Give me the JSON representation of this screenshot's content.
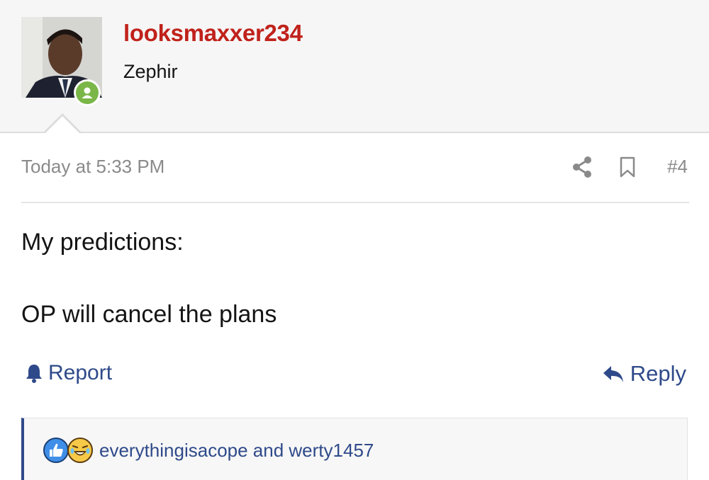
{
  "user": {
    "username": "looksmaxxer234",
    "title": "Zephir",
    "online": true
  },
  "post": {
    "date": "Today at 5:33 PM",
    "number": "#4",
    "body_line1": "My predictions:",
    "body_line2": "OP will cancel the plans"
  },
  "actions": {
    "report_label": "Report",
    "reply_label": "Reply"
  },
  "reactions": {
    "users_text": "everythingisacope and werty1457",
    "icons": [
      "like-icon",
      "laugh-icon"
    ]
  },
  "colors": {
    "username": "#c0221b",
    "link": "#2f4a8a",
    "online": "#7ab648",
    "meta": "#8a8a8a"
  }
}
